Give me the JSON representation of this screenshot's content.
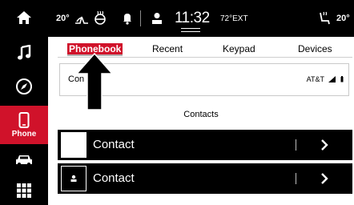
{
  "sidebar": {
    "items": [
      {
        "name": "home",
        "icon": "home-icon"
      },
      {
        "name": "media",
        "icon": "music-note-icon"
      },
      {
        "name": "navigation",
        "icon": "compass-icon"
      },
      {
        "name": "phone",
        "icon": "phone-icon",
        "label": "Phone",
        "active": true
      },
      {
        "name": "vehicle",
        "icon": "car-icon"
      },
      {
        "name": "apps",
        "icon": "grid-icon"
      }
    ]
  },
  "status": {
    "left_temp": "20°",
    "clock": "11:32",
    "outside_temp": "72°EXT",
    "right_temp": "20°"
  },
  "tabs": [
    {
      "label": "Phonebook",
      "selected": true
    },
    {
      "label": "Recent"
    },
    {
      "label": "Keypad"
    },
    {
      "label": "Devices"
    }
  ],
  "field": {
    "visible_label": "Con",
    "carrier": "AT&T"
  },
  "section_heading": "Contacts",
  "contacts": [
    {
      "label": "Contact",
      "avatar": "blank"
    },
    {
      "label": "Contact",
      "avatar": "person-icon"
    }
  ],
  "colors": {
    "accent": "#d0122a",
    "bar": "#000000",
    "background": "#ffffff"
  }
}
